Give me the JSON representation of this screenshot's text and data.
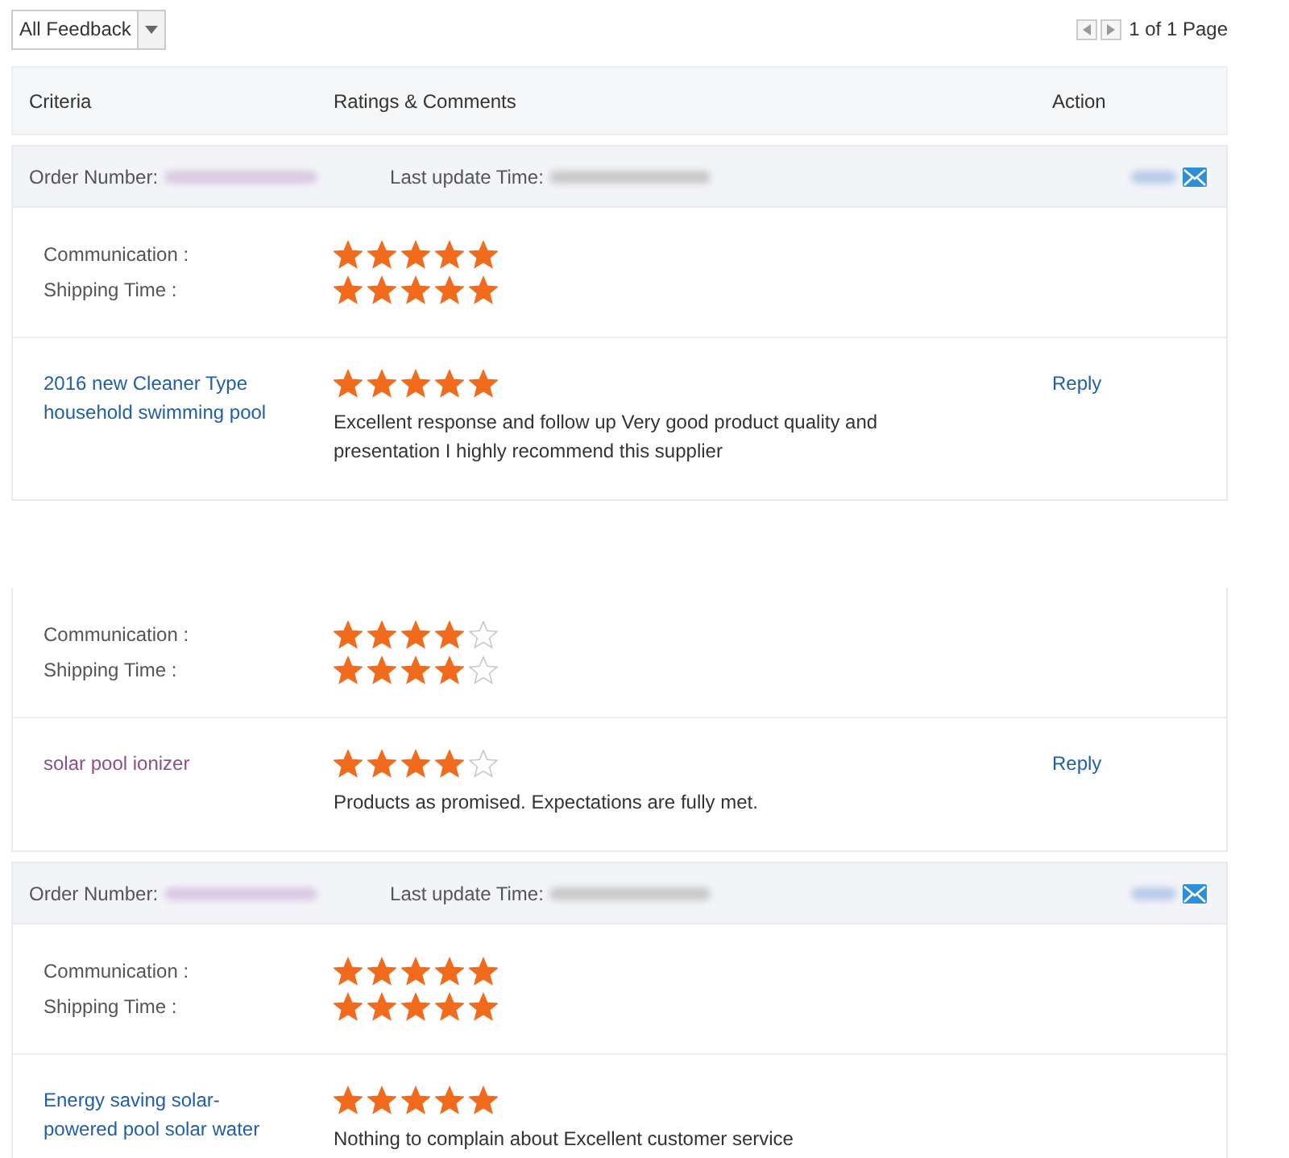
{
  "filter": {
    "value": "All Feedback"
  },
  "pager": {
    "text": "1 of 1 Page"
  },
  "columns": [
    "Criteria",
    "Ratings & Comments",
    "Action"
  ],
  "orders": [
    {
      "header": {
        "order_label": "Order Number:",
        "time_label": "Last update Time:"
      },
      "ratings": [
        {
          "label": "Communication :",
          "stars": 5
        },
        {
          "label": "Shipping Time :",
          "stars": 5
        }
      ],
      "product": {
        "name": "2016 new Cleaner Type household swimming pool",
        "visited": false,
        "stars": 5,
        "comment": "Excellent response and follow up Very good product quality and presentation I highly recommend this supplier",
        "action": "Reply"
      }
    },
    {
      "ratings": [
        {
          "label": "Communication :",
          "stars": 4
        },
        {
          "label": "Shipping Time :",
          "stars": 4
        }
      ],
      "product": {
        "name": "solar pool ionizer",
        "visited": true,
        "stars": 4,
        "comment": "Products as promised. Expectations are fully met.",
        "action": "Reply"
      }
    },
    {
      "header": {
        "order_label": "Order Number:",
        "time_label": "Last update Time:"
      },
      "ratings": [
        {
          "label": "Communication :",
          "stars": 5
        },
        {
          "label": "Shipping Time :",
          "stars": 5
        }
      ],
      "product": {
        "name": "Energy saving solar-powered pool solar water",
        "visited": false,
        "stars": 5,
        "comment": "Nothing to complain about Excellent customer service"
      }
    }
  ]
}
